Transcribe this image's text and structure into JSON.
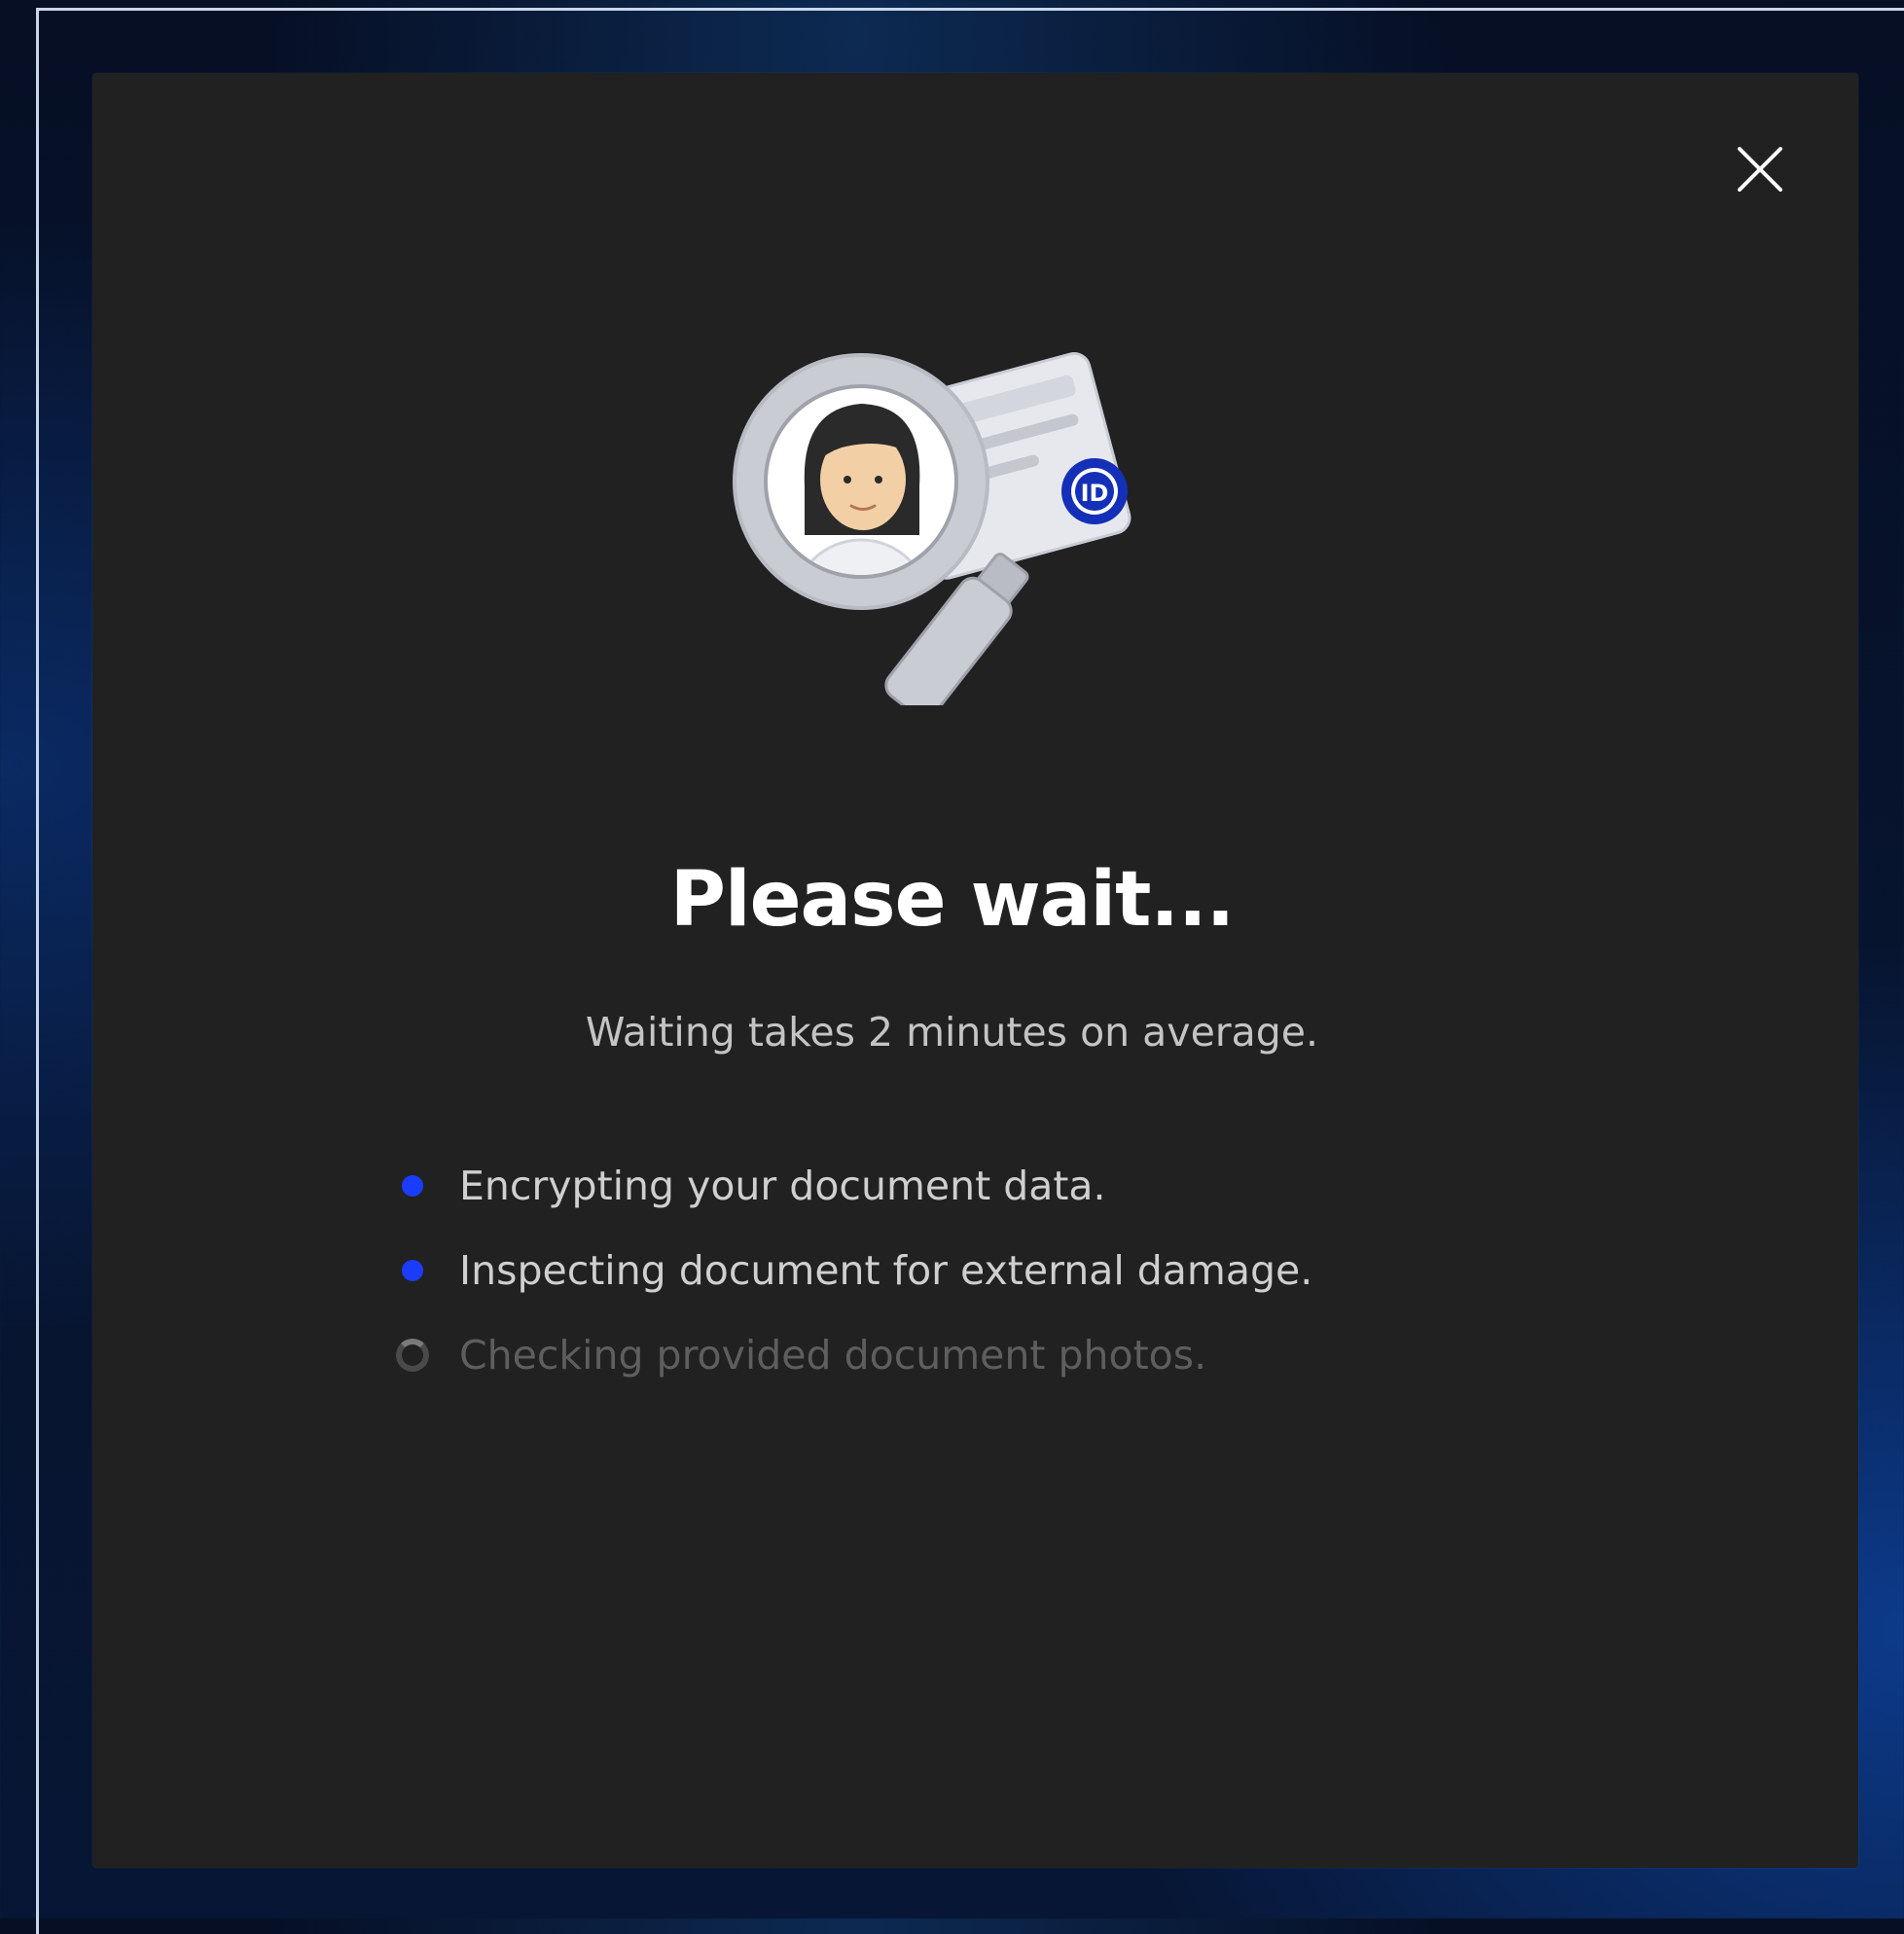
{
  "modal": {
    "close_icon": "close-icon",
    "illustration_icon": "id-verification-magnifier-icon",
    "illustration_badge": "ID",
    "title": "Please wait...",
    "subtitle": "Waiting takes 2 minutes on average.",
    "steps": [
      {
        "label": "Encrypting your document data.",
        "status": "done"
      },
      {
        "label": "Inspecting document for external damage.",
        "status": "done"
      },
      {
        "label": "Checking provided document photos.",
        "status": "in-progress"
      }
    ]
  },
  "colors": {
    "modal_bg": "#212121",
    "accent_blue": "#1a3cff",
    "title": "#ffffff",
    "text": "#cfcfcf",
    "text_pending": "#5e5e5e"
  }
}
